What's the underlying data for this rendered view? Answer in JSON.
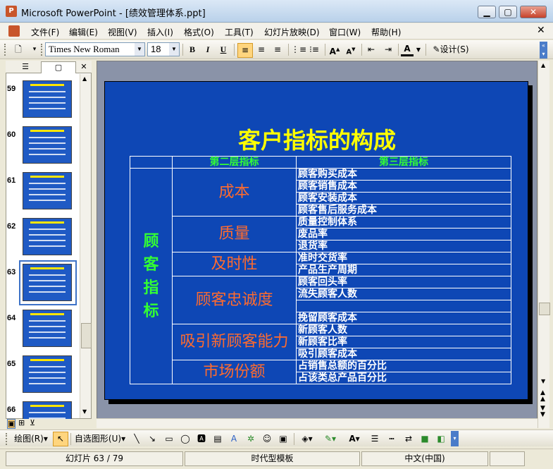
{
  "window": {
    "title": "Microsoft PowerPoint - [绩效管理体系.ppt]",
    "app_icon": "P"
  },
  "menu": [
    "文件(F)",
    "编辑(E)",
    "视图(V)",
    "插入(I)",
    "格式(O)",
    "工具(T)",
    "幻灯片放映(D)",
    "窗口(W)",
    "帮助(H)"
  ],
  "toolbar": {
    "font": "Times New Roman",
    "size": "18",
    "bold": "B",
    "italic": "I",
    "underline": "U",
    "design_label": "设计(S)"
  },
  "slides_panel": {
    "items": [
      {
        "num": "59"
      },
      {
        "num": "60"
      },
      {
        "num": "61"
      },
      {
        "num": "62"
      },
      {
        "num": "63",
        "selected": true
      },
      {
        "num": "64"
      },
      {
        "num": "65"
      },
      {
        "num": "66"
      }
    ]
  },
  "slide": {
    "title": "客户指标的构成",
    "headers": [
      "第二层指标",
      "第三层指标"
    ],
    "level1": [
      "顾",
      "客",
      "指",
      "标"
    ],
    "groups": [
      {
        "name": "成本",
        "items": [
          "顾客购买成本",
          "顾客销售成本",
          "顾客安装成本",
          "顾客售后服务成本"
        ]
      },
      {
        "name": "质量",
        "items": [
          "质量控制体系",
          "废品率",
          "退货率"
        ]
      },
      {
        "name": "及时性",
        "items": [
          "准时交货率",
          "产品生产周期"
        ]
      },
      {
        "name": "顾客忠诚度",
        "items": [
          "顾客回头率",
          "流失顾客人数",
          "",
          "挽留顾客成本"
        ]
      },
      {
        "name": "吸引新顾客能力",
        "items": [
          "新顾客人数",
          "新顾客比率",
          "吸引顾客成本"
        ]
      },
      {
        "name": "市场份额",
        "items": [
          "占销售总额的百分比",
          "占该类总产品百分比"
        ]
      }
    ]
  },
  "drawbar": {
    "draw_label": "绘图(R)",
    "autoshape_label": "自选图形(U)"
  },
  "status": {
    "slide_info": "幻灯片 63 / 79",
    "template": "时代型模板",
    "language": "中文(中国)"
  },
  "colors": {
    "slide_bg": "#0e47b5",
    "title": "#ffff00",
    "header": "#33ff33",
    "level2": "#ff6b2e"
  }
}
